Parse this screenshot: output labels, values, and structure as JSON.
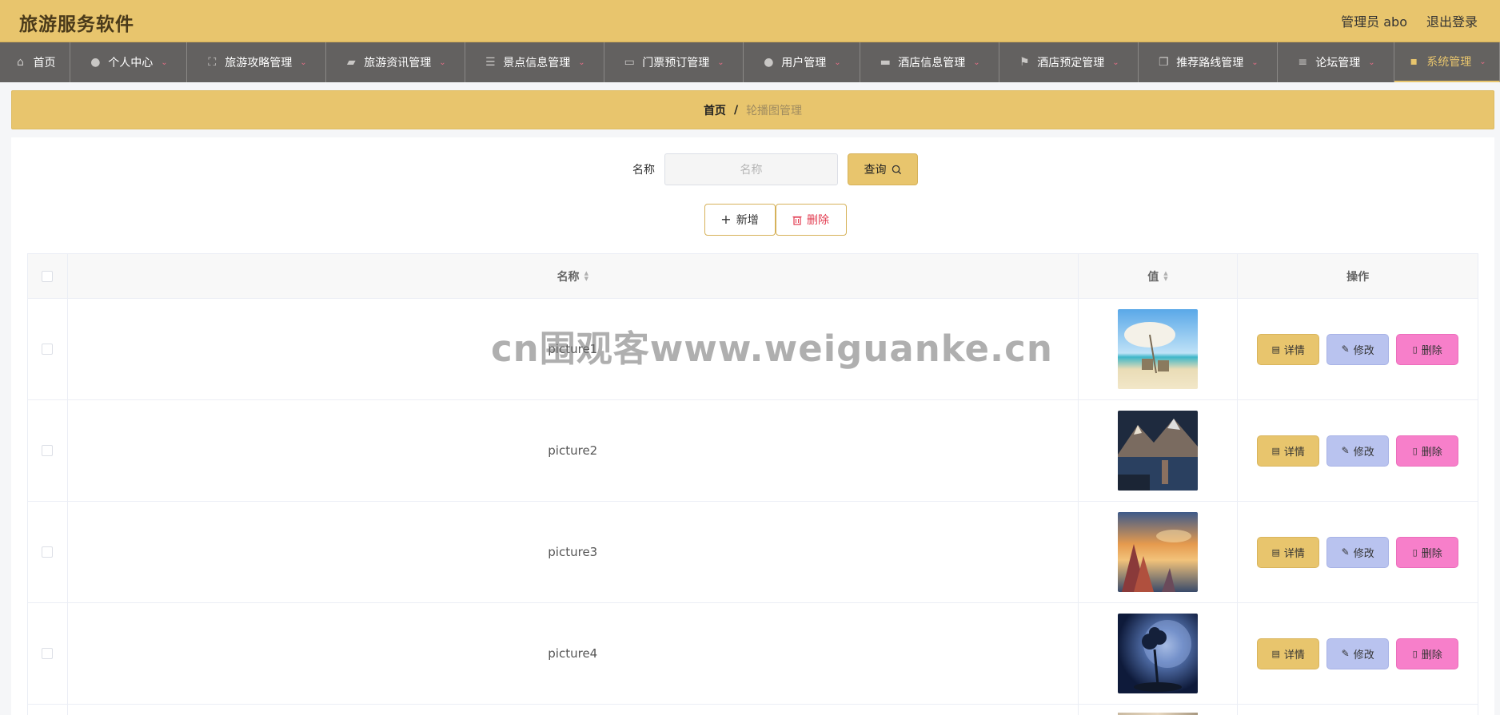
{
  "header": {
    "title": "旅游服务软件",
    "user_label": "管理员 abo",
    "logout_label": "退出登录"
  },
  "nav": {
    "items": [
      {
        "label": "首页",
        "icon": "home-icon",
        "glyph": "⌂",
        "has_dropdown": false
      },
      {
        "label": "个人中心",
        "icon": "user-icon",
        "glyph": "●",
        "has_dropdown": true
      },
      {
        "label": "旅游攻略管理",
        "icon": "fullscreen-icon",
        "glyph": "⛶",
        "has_dropdown": true
      },
      {
        "label": "旅游资讯管理",
        "icon": "wallet-icon",
        "glyph": "▰",
        "has_dropdown": true
      },
      {
        "label": "景点信息管理",
        "icon": "sliders-icon",
        "glyph": "☰",
        "has_dropdown": true
      },
      {
        "label": "门票预订管理",
        "icon": "chat-icon",
        "glyph": "▭",
        "has_dropdown": true
      },
      {
        "label": "用户管理",
        "icon": "user-icon",
        "glyph": "●",
        "has_dropdown": true
      },
      {
        "label": "酒店信息管理",
        "icon": "printer-icon",
        "glyph": "▬",
        "has_dropdown": true
      },
      {
        "label": "酒店预定管理",
        "icon": "flag-icon",
        "glyph": "⚑",
        "has_dropdown": true
      },
      {
        "label": "推荐路线管理",
        "icon": "copy-icon",
        "glyph": "❐",
        "has_dropdown": true
      },
      {
        "label": "论坛管理",
        "icon": "menu-icon",
        "glyph": "≡",
        "has_dropdown": true
      },
      {
        "label": "系统管理",
        "icon": "message-icon",
        "glyph": "▪",
        "has_dropdown": true,
        "active": true
      }
    ]
  },
  "breadcrumb": {
    "home": "首页",
    "separator": "/",
    "current": "轮播图管理"
  },
  "search": {
    "label": "名称",
    "placeholder": "名称",
    "value": "",
    "button_label": "查询"
  },
  "actions": {
    "add_label": "新增",
    "delete_label": "删除"
  },
  "table": {
    "columns": {
      "name": "名称",
      "value": "值",
      "ops": "操作"
    },
    "rows": [
      {
        "name": "picture1",
        "image": "beach-umbrella-image"
      },
      {
        "name": "picture2",
        "image": "mountain-lake-image"
      },
      {
        "name": "picture3",
        "image": "sunset-rocks-image"
      },
      {
        "name": "picture4",
        "image": "moon-tree-image"
      }
    ],
    "op_labels": {
      "detail": "详情",
      "edit": "修改",
      "delete": "删除"
    }
  },
  "watermark": "cn围观客www.weiguanke.cn",
  "colors": {
    "accent": "#e8c56d",
    "nav_bg": "#636160",
    "edit": "#b9c3ef",
    "danger": "#f77fca"
  }
}
